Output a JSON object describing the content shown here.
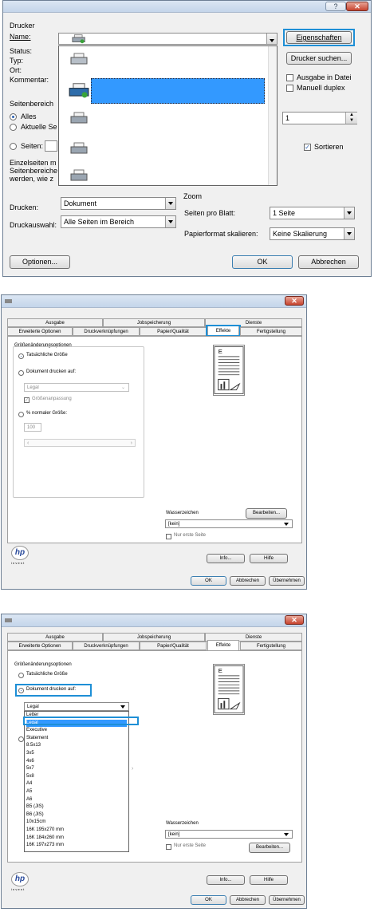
{
  "print_dialog": {
    "help_glyph": "?",
    "close_glyph": "✕",
    "printer_group": "Drucker",
    "name_label": "Name:",
    "status_label": "Status:",
    "type_label": "Typ:",
    "location_label": "Ort:",
    "comment_label": "Kommentar:",
    "properties_button": "Eigenschaften",
    "find_printer_button": "Drucker suchen...",
    "print_to_file": "Ausgabe in Datei",
    "manual_duplex": "Manuell duplex",
    "page_range_group": "Seitenbereich",
    "range_all": "Alles",
    "range_current": "Aktuelle Se",
    "range_pages": "Seiten:",
    "range_hint_1": "Einzelseiten m",
    "range_hint_2": "Seitenbereiche",
    "range_hint_3": "werden, wie z",
    "copies_value": "1",
    "collate_label": "Sortieren",
    "print_what_label": "Drucken:",
    "print_what_value": "Dokument",
    "print_selection_label": "Druckauswahl:",
    "print_selection_value": "Alle Seiten im Bereich",
    "zoom_group": "Zoom",
    "pages_per_sheet_label": "Seiten pro Blatt:",
    "pages_per_sheet_value": "1 Seite",
    "scale_label": "Papierformat skalieren:",
    "scale_value": "Keine Skalierung",
    "options_button": "Optionen...",
    "ok_button": "OK",
    "cancel_button": "Abbrechen"
  },
  "props_dialog_1": {
    "close_glyph": "✕",
    "tabs_row1": [
      "Ausgabe",
      "Jobspeicherung",
      "Dienste"
    ],
    "tabs_row2": [
      "Erweiterte Optionen",
      "Druckverknüpfungen",
      "Papier/Qualität",
      "Effekte",
      "Fertigstellung"
    ],
    "resize_group": "Größenänderungsoptionen",
    "actual_size": "Tatsächliche Größe",
    "print_on": "Dokument drucken auf:",
    "paper_value": "Legal",
    "scale_to_fit": "Größenanpassung",
    "percent_normal": "% normaler Größe:",
    "percent_value": "100",
    "watermark_label": "Wasserzeichen",
    "watermark_value": "[kein]",
    "first_page_only": "Nur erste Seite",
    "edit_button": "Bearbeiten...",
    "info_button": "Info...",
    "help_button": "Hilfe",
    "ok_button": "OK",
    "cancel_button": "Abbrechen",
    "apply_button": "Übernehmen",
    "hp_logo": "hp",
    "invent": "i n v e n t"
  },
  "props_dialog_2": {
    "close_glyph": "✕",
    "tabs_row1": [
      "Ausgabe",
      "Jobspeicherung",
      "Dienste"
    ],
    "tabs_row2": [
      "Erweiterte Optionen",
      "Druckverknüpfungen",
      "Papier/Qualität",
      "Effekte",
      "Fertigstellung"
    ],
    "resize_group": "Größenänderungsoptionen",
    "actual_size": "Tatsächliche Größe",
    "print_on": "Dokument drucken auf:",
    "paper_value": "Legal",
    "paper_options": [
      "Letter",
      "Legal",
      "Executive",
      "Statement",
      "8.5x13",
      "3x5",
      "4x6",
      "5x7",
      "5x8",
      "A4",
      "A5",
      "A6",
      "B5 (JIS)",
      "B6 (JIS)",
      "10x15cm",
      "16K 195x270 mm",
      "16K 184x260 mm",
      "16K 197x273 mm"
    ],
    "watermark_label": "Wasserzeichen",
    "watermark_value": "[kein]",
    "first_page_only": "Nur erste Seite",
    "edit_button": "Bearbeiten...",
    "info_button": "Info...",
    "help_button": "Hilfe",
    "ok_button": "OK",
    "cancel_button": "Abbrechen",
    "apply_button": "Übernehmen",
    "hp_logo": "hp",
    "invent": "i n v e n t"
  }
}
